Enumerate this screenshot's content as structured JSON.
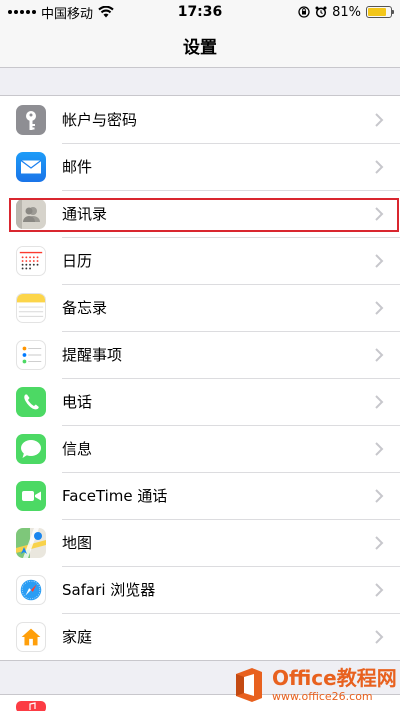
{
  "status": {
    "carrier": "中国移动",
    "time": "17:36",
    "battery_pct": "81%",
    "battery_level": 0.81,
    "battery_color": "#f3c619"
  },
  "nav": {
    "title": "设置"
  },
  "settings": {
    "items": [
      {
        "label": "帐户与密码",
        "icon": "key-icon",
        "color": "#8e8e93"
      },
      {
        "label": "邮件",
        "icon": "mail-icon",
        "color": "#1a8cf5"
      },
      {
        "label": "通讯录",
        "icon": "contacts-icon",
        "color": "#c8c6c0"
      },
      {
        "label": "日历",
        "icon": "calendar-icon",
        "color": "#ffffff"
      },
      {
        "label": "备忘录",
        "icon": "notes-icon",
        "color": "#fcd54a"
      },
      {
        "label": "提醒事项",
        "icon": "reminders-icon",
        "color": "#ffffff"
      },
      {
        "label": "电话",
        "icon": "phone-icon",
        "color": "#4cd964"
      },
      {
        "label": "信息",
        "icon": "messages-icon",
        "color": "#4cd964"
      },
      {
        "label": "FaceTime 通话",
        "icon": "facetime-icon",
        "color": "#4cd964"
      },
      {
        "label": "地图",
        "icon": "maps-icon",
        "color": "#e8e6df"
      },
      {
        "label": "Safari 浏览器",
        "icon": "safari-icon",
        "color": "#ffffff"
      },
      {
        "label": "家庭",
        "icon": "home-icon",
        "color": "#ffffff"
      }
    ]
  },
  "highlight_color": "#d9262f",
  "watermark": {
    "brand": "Office教程网",
    "url": "www.office26.com"
  }
}
